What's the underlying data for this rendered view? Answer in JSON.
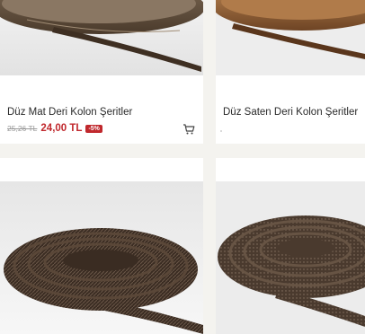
{
  "products": [
    {
      "title": "Düz Mat Deri Kolon Şeritler",
      "old_price": "25,26 TL",
      "price": "24,00 TL",
      "discount": "-5%",
      "icon": "cart-icon"
    },
    {
      "title": "Düz Saten Deri Kolon Şeritler"
    }
  ],
  "colors": {
    "accent": "#c0282d",
    "background": "#f4f3ef",
    "card": "#ffffff"
  }
}
